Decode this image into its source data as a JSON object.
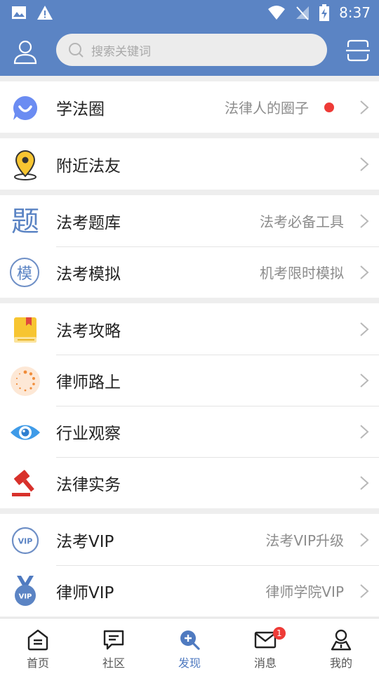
{
  "status_bar": {
    "time": "8:37"
  },
  "header": {
    "search_placeholder": "搜索关键词"
  },
  "colors": {
    "brand": "#5b84c4",
    "accent": "#4f7ac0",
    "badge": "#ee3b37"
  },
  "groups": [
    [
      {
        "title": "学法圈",
        "sub": "法律人的圈子",
        "icon": "chat-bubble-icon",
        "dot": true
      }
    ],
    [
      {
        "title": "附近法友",
        "sub": "",
        "icon": "location-pin-icon"
      }
    ],
    [
      {
        "title": "法考题库",
        "sub": "法考必备工具",
        "icon": "question-bank-icon",
        "glyph": "题"
      },
      {
        "title": "法考模拟",
        "sub": "机考限时模拟",
        "icon": "mock-exam-icon",
        "glyph": "模"
      }
    ],
    [
      {
        "title": "法考攻略",
        "sub": "",
        "icon": "book-icon"
      },
      {
        "title": "律师路上",
        "sub": "",
        "icon": "loading-circle-icon"
      },
      {
        "title": "行业观察",
        "sub": "",
        "icon": "eye-icon"
      },
      {
        "title": "法律实务",
        "sub": "",
        "icon": "gavel-icon"
      }
    ],
    [
      {
        "title": "法考VIP",
        "sub": "法考VIP升级",
        "icon": "vip-badge-icon"
      },
      {
        "title": "律师VIP",
        "sub": "律师学院VIP",
        "icon": "vip-medal-icon"
      }
    ]
  ],
  "tabbar": [
    {
      "label": "首页",
      "icon": "home-icon",
      "active": false
    },
    {
      "label": "社区",
      "icon": "message-square-icon",
      "active": false
    },
    {
      "label": "发现",
      "icon": "discover-search-icon",
      "active": true
    },
    {
      "label": "消息",
      "icon": "mail-icon",
      "active": false,
      "badge": "1"
    },
    {
      "label": "我的",
      "icon": "profile-icon",
      "active": false
    }
  ]
}
